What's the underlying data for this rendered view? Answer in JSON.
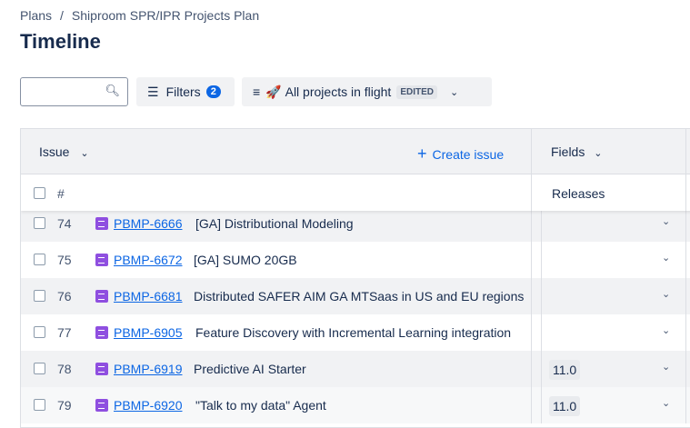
{
  "breadcrumb": {
    "root": "Plans",
    "separator": "/",
    "current": "Shiproom SPR/IPR Projects Plan"
  },
  "title": "Timeline",
  "toolbar": {
    "search_placeholder": "",
    "filters_label": "Filters",
    "filters_count": "2",
    "view_emoji": "🚀",
    "view_label": "All projects in flight",
    "view_badge": "EDITED"
  },
  "table": {
    "issue_header": "Issue",
    "create_label": "Create issue",
    "fields_header": "Fields",
    "number_header": "#",
    "releases_header": "Releases",
    "rows": [
      {
        "num": "74",
        "key": "PBMP-6666",
        "summary": "[GA] Distributional Modeling",
        "release": ""
      },
      {
        "num": "75",
        "key": "PBMP-6672",
        "summary": "[GA] SUMO 20GB",
        "release": ""
      },
      {
        "num": "76",
        "key": "PBMP-6681",
        "summary": "Distributed SAFER AIM GA MTSaas in US and EU regions",
        "release": ""
      },
      {
        "num": "77",
        "key": "PBMP-6905",
        "summary": "Feature Discovery with Incremental Learning integration",
        "release": ""
      },
      {
        "num": "78",
        "key": "PBMP-6919",
        "summary": "Predictive AI Starter",
        "release": "11.0"
      },
      {
        "num": "79",
        "key": "PBMP-6920",
        "summary": "\"Talk to my data\" Agent",
        "release": "11.0"
      }
    ]
  },
  "colors": {
    "accent": "#0c66e4",
    "epic": "#8f4fe0"
  }
}
